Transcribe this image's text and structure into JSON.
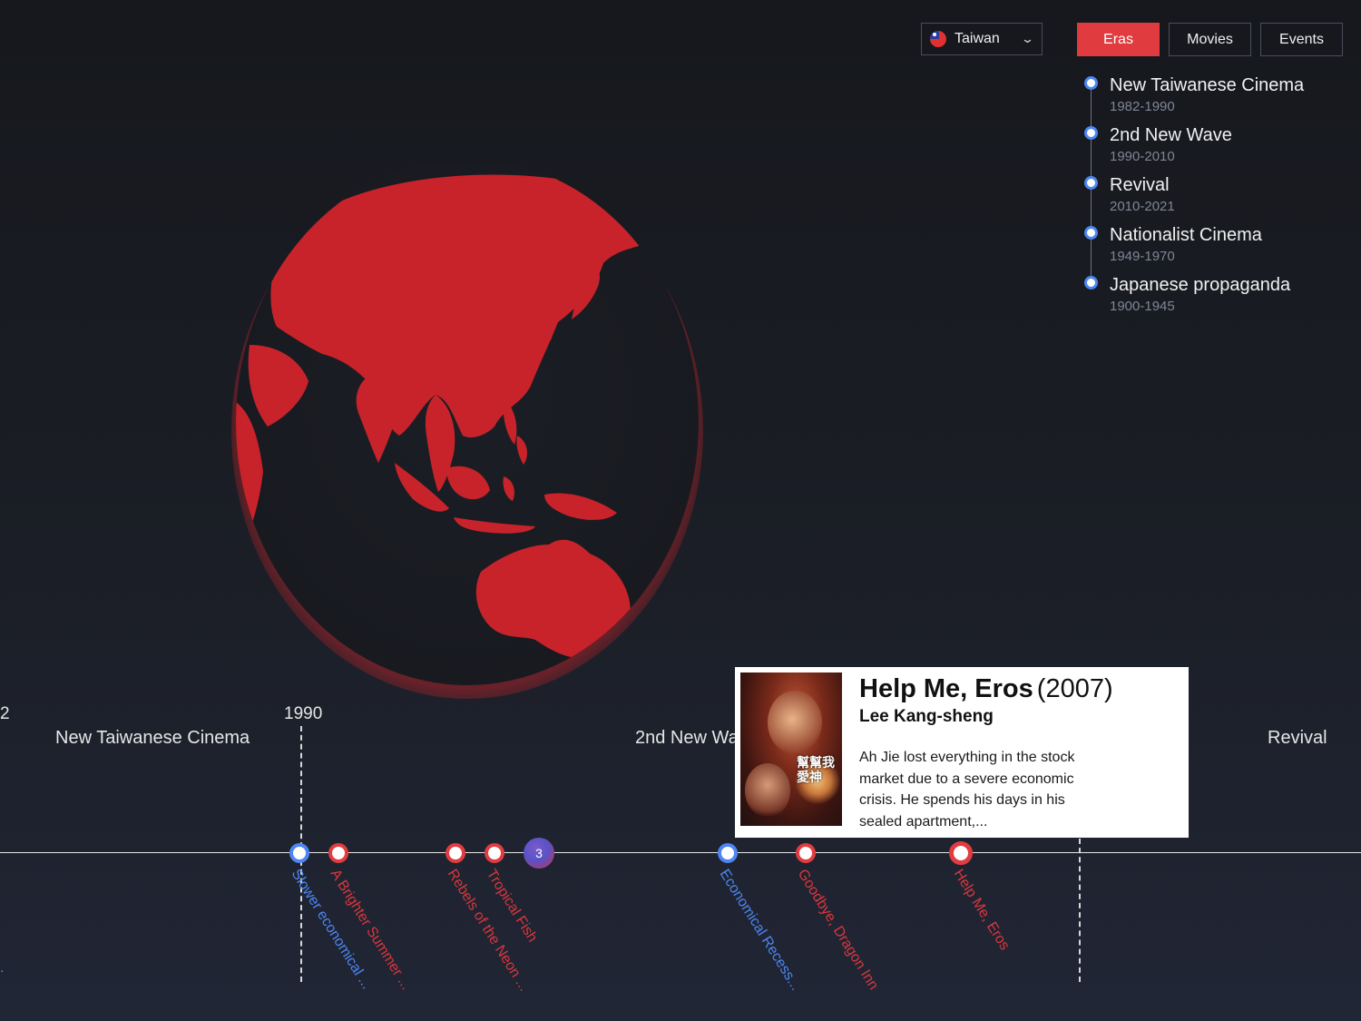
{
  "country_select": {
    "value": "Taiwan",
    "flag_icon": "taiwan-flag-icon",
    "chevron_icon": "chevron-down-icon"
  },
  "tabs": [
    {
      "label": "Eras",
      "active": true
    },
    {
      "label": "Movies",
      "active": false
    },
    {
      "label": "Events",
      "active": false
    }
  ],
  "eras": [
    {
      "name": "New Taiwanese Cinema",
      "years": "1982-1990"
    },
    {
      "name": "2nd New Wave",
      "years": "1990-2010"
    },
    {
      "name": "Revival",
      "years": "2010-2021"
    },
    {
      "name": "Nationalist Cinema",
      "years": "1949-1970"
    },
    {
      "name": "Japanese propaganda",
      "years": "1900-1945"
    }
  ],
  "timeline": {
    "tick_left_partial": "2",
    "tick_1990": "1990",
    "era_labels": {
      "left": "New Taiwanese Cinema",
      "middle": "2nd New Wave",
      "right": "Revival"
    },
    "cluster_count": "3",
    "movies": [
      {
        "title": "Slower economical ...",
        "type": "event"
      },
      {
        "title": "A Brighter Summer ...",
        "type": "movie"
      },
      {
        "title": "Rebels of the Neon ...",
        "type": "movie"
      },
      {
        "title": "Tropical Fish",
        "type": "movie"
      },
      {
        "title": "Economical Recess...",
        "type": "event"
      },
      {
        "title": "Goodbye, Dragon Inn",
        "type": "movie"
      },
      {
        "title": "Help Me, Eros",
        "type": "movie"
      }
    ],
    "left_edge_partial": "."
  },
  "tooltip": {
    "title": "Help Me, Eros",
    "year": "(2007)",
    "director": "Lee Kang-sheng",
    "description": "Ah Jie lost everything in the stock market due to a severe economic crisis. He spends his days in his sealed apartment,...",
    "poster_text": "幫幫我愛神"
  },
  "colors": {
    "accent": "#e03b3e",
    "event_blue": "#4d86f2",
    "globe_red": "#c8232a"
  }
}
